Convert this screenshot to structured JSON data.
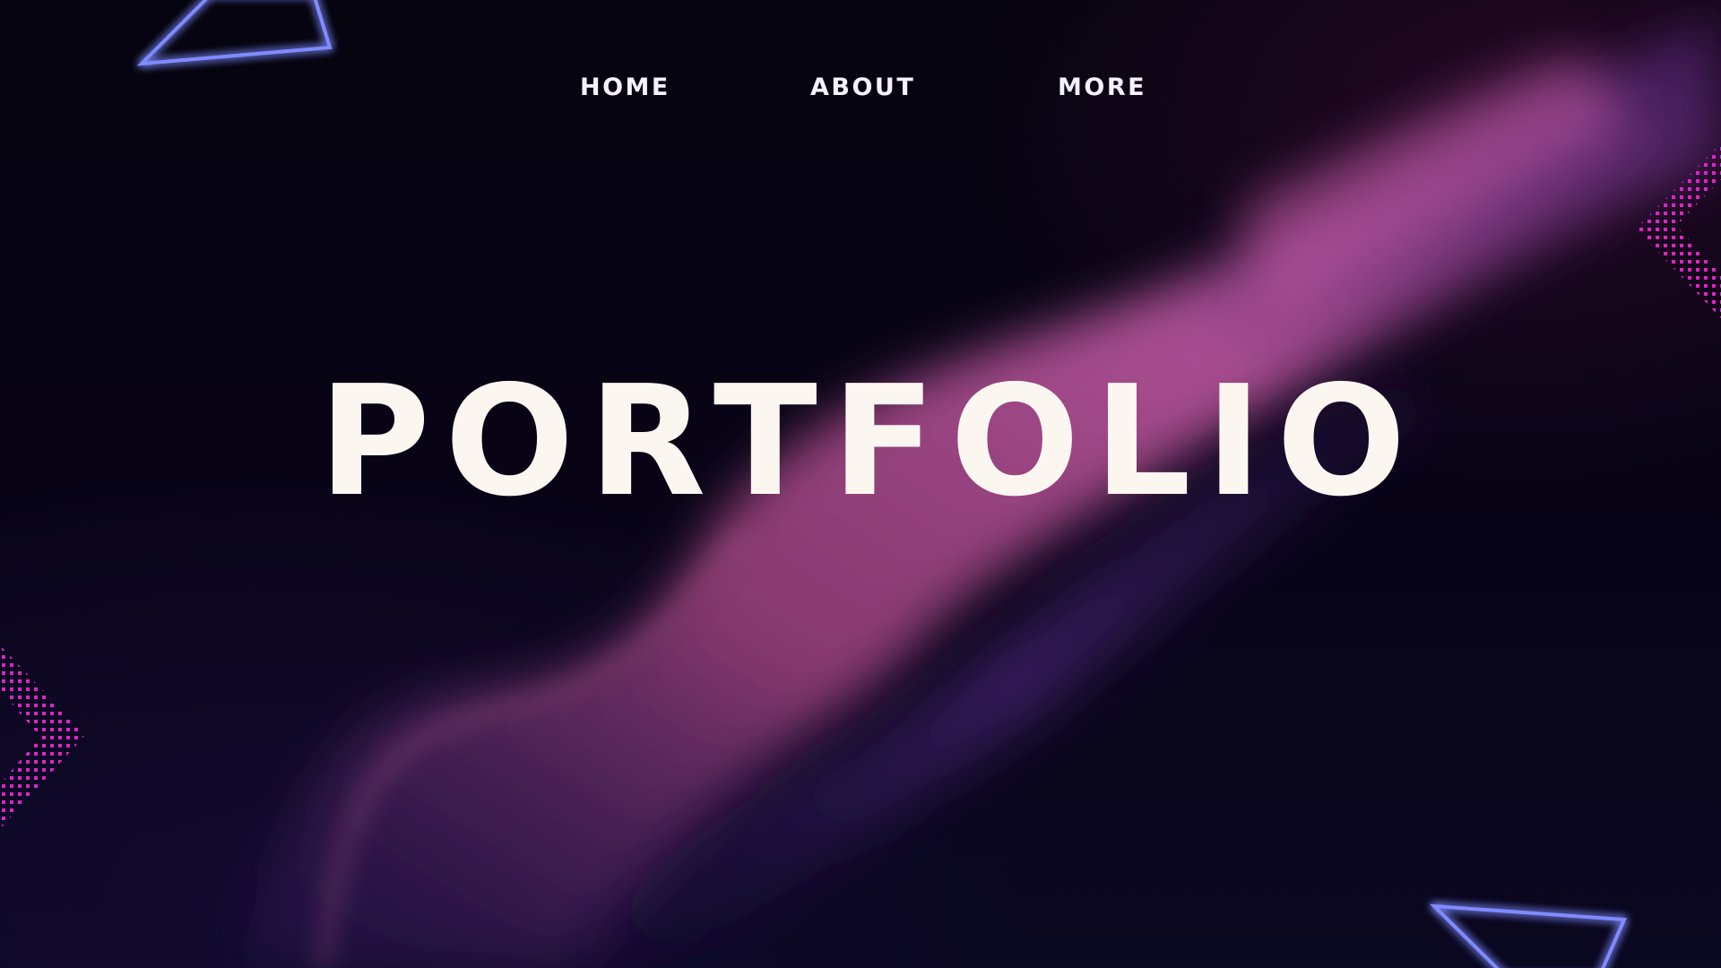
{
  "nav": {
    "items": [
      {
        "label": "HOME"
      },
      {
        "label": "ABOUT"
      },
      {
        "label": "MORE"
      }
    ]
  },
  "hero": {
    "title": "PORTFOLIO"
  },
  "colors": {
    "background": "#05040f",
    "title": "#fbf7f0",
    "nav_text": "#f5f1ff",
    "neon_triangle": "#6f7cff",
    "dot_pattern": "#e022c8",
    "smoke_pink": "#c45aa6",
    "smoke_purple": "#5a2c8c"
  },
  "decorations": {
    "icons": [
      "neon-triangle-icon",
      "dot-chevron-icon",
      "smoke-wave"
    ]
  }
}
